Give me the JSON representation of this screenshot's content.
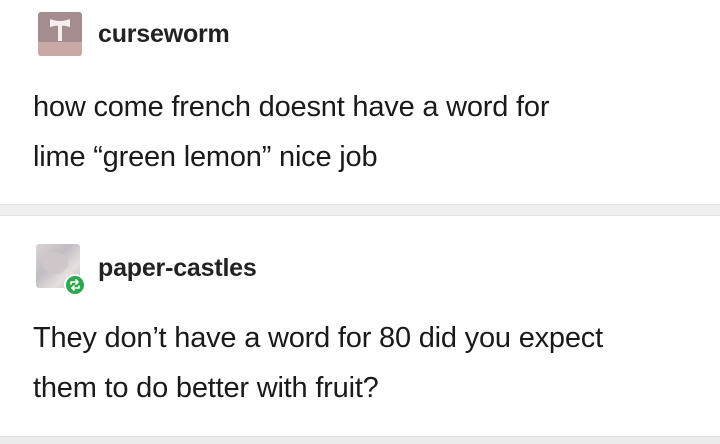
{
  "posts": [
    {
      "username": "curseworm",
      "avatar_icon": "axe-icon",
      "lines": [
        "how come french doesnt have a word for",
        "lime “green lemon” nice job"
      ]
    },
    {
      "username": "paper-castles",
      "avatar_icon": "reblog-icon",
      "badge_color": "#2ea84f",
      "lines": [
        "They don’t have a word for 80 did you expect",
        "them to do better with fruit?"
      ]
    }
  ]
}
